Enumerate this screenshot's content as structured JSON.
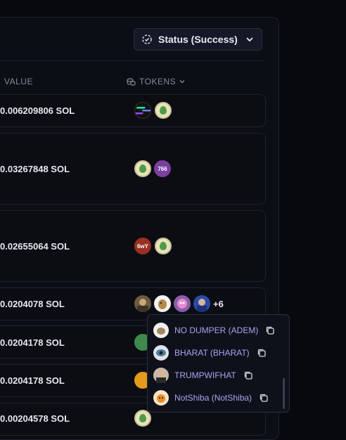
{
  "filter": {
    "status_label": "Status (Success)"
  },
  "columns": {
    "value": "VALUE",
    "tokens": "TOKENS"
  },
  "rows": [
    {
      "value": "0.006209806 SOL"
    },
    {
      "value": "0.03267848 SOL",
      "badge": "766"
    },
    {
      "value": "0.02655064 SOL",
      "badge": "6wY"
    },
    {
      "value": "0.0204078 SOL",
      "more": "+6"
    },
    {
      "value": "0.0204178 SOL"
    },
    {
      "value": "0.0204178 SOL"
    },
    {
      "value": "0.00204578 SOL"
    }
  ],
  "popup": {
    "items": [
      {
        "label": "NO DUMPER (ADEM)"
      },
      {
        "label": "BHARAT (BHARAT)"
      },
      {
        "label": "TRUMPWIFHAT"
      },
      {
        "label": "NotShiba (NotShiba)"
      }
    ]
  },
  "colors": {
    "accent": "#a7a3f2",
    "background": "#08090e",
    "panel": "#0c0e15"
  }
}
